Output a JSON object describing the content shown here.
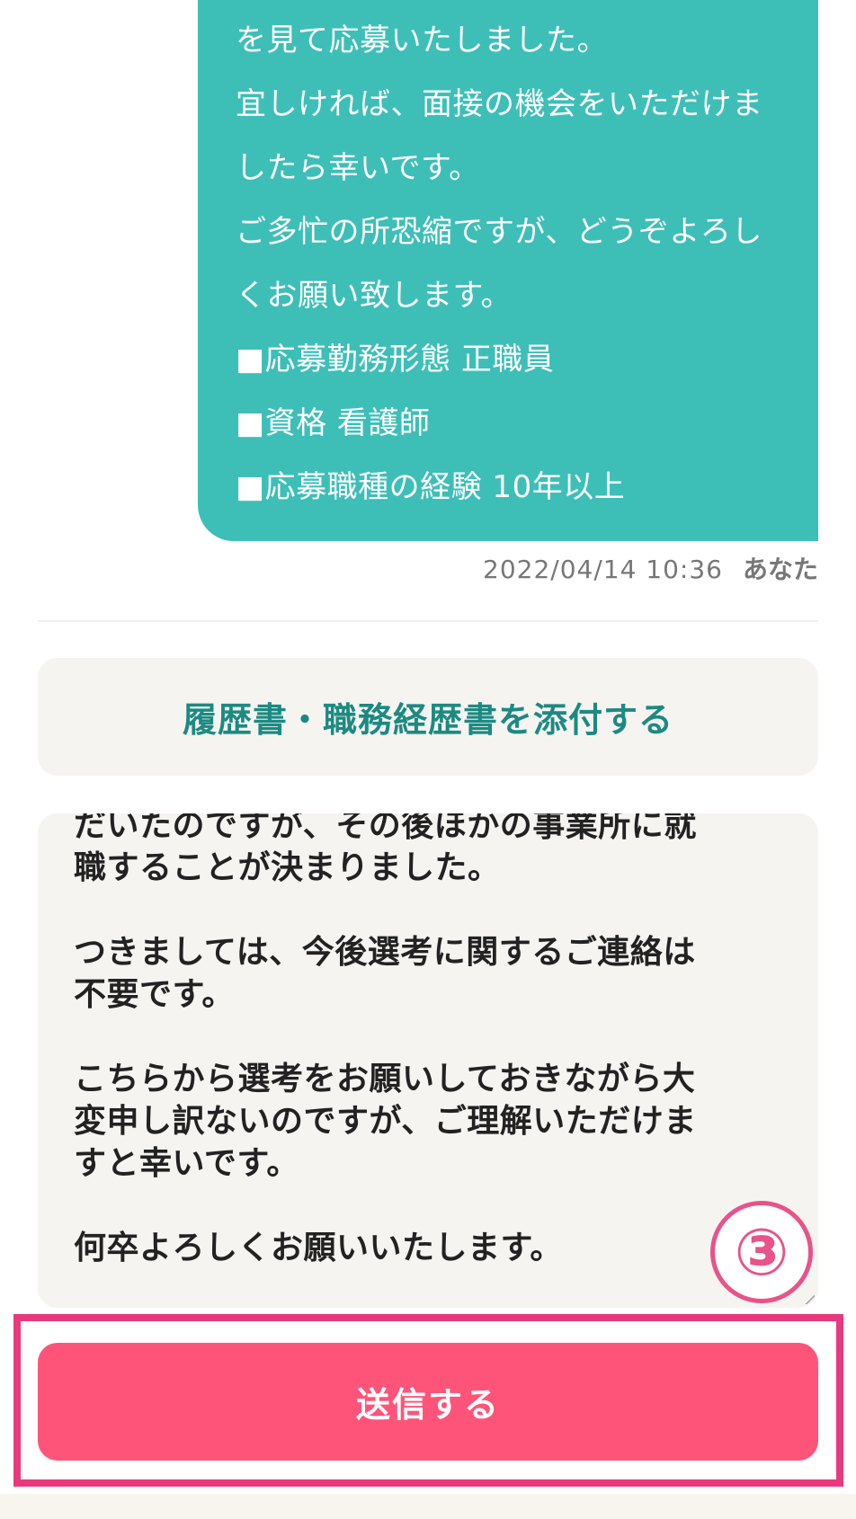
{
  "chat": {
    "bubble_lines": [
      "を見て応募いたしました。",
      "宜しければ、面接の機会をいただけま",
      "したら幸いです。",
      "ご多忙の所恐縮ですが、どうぞよろし",
      "くお願い致します。",
      "■応募勤務形態 正職員",
      "■資格 看護師",
      "■応募職種の経験 10年以上"
    ],
    "timestamp": "2022/04/14 10:36",
    "sender": "あなた"
  },
  "attach_button": {
    "label": "履歴書・職務経歴書を添付する"
  },
  "message_input": {
    "value": "だいたのですが、その後ほかの事業所に就\n職することが決まりました。\n\nつきましては、今後選考に関するご連絡は\n不要です。\n\nこちらから選考をお願いしておきながら大\n変申し訳ないのですが、ご理解いただけま\nすと幸いです。\n\n何卒よろしくお願いいたします。"
  },
  "annotation": {
    "step_label": "③",
    "color": "#e8397f"
  },
  "send_button": {
    "label": "送信する",
    "color": "#ff5479"
  },
  "colors": {
    "bubble": "#3dbfb8",
    "attach_text": "#1c8a82",
    "input_bg": "#f6f4f1"
  }
}
